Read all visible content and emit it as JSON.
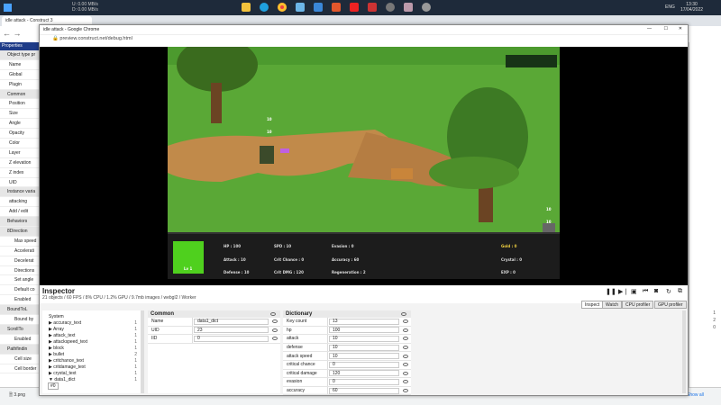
{
  "taskbar": {
    "net_up": "0.00 MB/s",
    "net_down": "0.00 MB/s",
    "net_u": "U:",
    "net_d": "D:",
    "lang": "ENG",
    "time": "13:30",
    "date": "17/04/2022"
  },
  "bg_browser": {
    "tab_title": "idle attack - Construct 3",
    "download_file": "3.png",
    "show_all": "Show all"
  },
  "properties": {
    "header": "Properties",
    "rows": [
      {
        "label": "Object type pr",
        "kind": "sec"
      },
      {
        "label": "Name"
      },
      {
        "label": "Global"
      },
      {
        "label": "Plugin"
      },
      {
        "label": "Common",
        "kind": "sec"
      },
      {
        "label": "Position"
      },
      {
        "label": "Size"
      },
      {
        "label": "Angle"
      },
      {
        "label": "Opacity"
      },
      {
        "label": "Color"
      },
      {
        "label": "Layer"
      },
      {
        "label": "Z elevation"
      },
      {
        "label": "Z index"
      },
      {
        "label": "UID"
      },
      {
        "label": "Instance varia",
        "kind": "sec"
      },
      {
        "label": "attacking"
      },
      {
        "label": "Add / edit"
      },
      {
        "label": "Behaviors",
        "kind": "sec"
      },
      {
        "label": "8Direction",
        "kind": "sec"
      },
      {
        "label": "Max speed",
        "kind": "sub"
      },
      {
        "label": "Accelerati",
        "kind": "sub"
      },
      {
        "label": "Decelerat",
        "kind": "sub"
      },
      {
        "label": "Directions",
        "kind": "sub"
      },
      {
        "label": "Set angle",
        "kind": "sub"
      },
      {
        "label": "Default co",
        "kind": "sub"
      },
      {
        "label": "Enabled",
        "kind": "sub"
      },
      {
        "label": "BoundToL",
        "kind": "sec"
      },
      {
        "label": "Bound by",
        "kind": "sub"
      },
      {
        "label": "ScrollTo",
        "kind": "sec"
      },
      {
        "label": "Enabled",
        "kind": "sub"
      },
      {
        "label": "Pathfindin",
        "kind": "sec"
      },
      {
        "label": "Cell size",
        "kind": "sub"
      },
      {
        "label": "Cell border",
        "kind": "sub"
      }
    ]
  },
  "right_strip": {
    "values": [
      "1",
      "2",
      "0"
    ]
  },
  "window": {
    "title": "idle attack - Google Chrome",
    "url": "preview.construct.net/debug.html"
  },
  "game": {
    "hud": {
      "level": "Lv 1",
      "hp": "HP : 100",
      "spd": "SPD : 10",
      "evasion": "Evasion : 0",
      "gold": "Gold : 0",
      "attack": "Attack : 10",
      "crit_chance": "Crit Chance : 0",
      "accuracy": "Accuracy : 60",
      "crystal": "Crystal : 0",
      "defense": "Defense : 10",
      "crit_dmg": "Crit DMG : 120",
      "regen": "Regeneration : 2",
      "exp": "EXP : 0"
    },
    "dmg_popup_1": "10",
    "dmg_popup_2": "10",
    "enemy_hp_1": "10",
    "enemy_hp_2": "10"
  },
  "inspector": {
    "title": "Inspector",
    "stats": "21 objects / 60 FPS / 8% CPU / 1.2% GPU / 9.7mb images / webgl2 / Worker",
    "tabs": [
      "Inspect",
      "Watch",
      "CPU profiler",
      "GPU profiler"
    ],
    "tree": [
      {
        "label": "System",
        "count": ""
      },
      {
        "label": "▶ accuracy_text",
        "count": "1"
      },
      {
        "label": "▶ Array",
        "count": "1"
      },
      {
        "label": "▶ attack_text",
        "count": "1"
      },
      {
        "label": "▶ attackspeed_text",
        "count": "1"
      },
      {
        "label": "▶ block",
        "count": "1"
      },
      {
        "label": "▶ bullet",
        "count": "2"
      },
      {
        "label": "▶ critchance_text",
        "count": "1"
      },
      {
        "label": "▶ critdamage_text",
        "count": "1"
      },
      {
        "label": "▶ crystal_text",
        "count": "1"
      },
      {
        "label": "▼ data1_dict",
        "count": "1"
      }
    ],
    "tree_selected": "#0",
    "common": {
      "header": "Common",
      "rows": [
        {
          "k": "Name",
          "v": "data1_dict"
        },
        {
          "k": "UID",
          "v": "23"
        },
        {
          "k": "IID",
          "v": "0"
        }
      ]
    },
    "dictionary": {
      "header": "Dictionary",
      "rows": [
        {
          "k": "Key count",
          "v": "13"
        },
        {
          "k": "hp",
          "v": "100"
        },
        {
          "k": "attack",
          "v": "10"
        },
        {
          "k": "defense",
          "v": "10"
        },
        {
          "k": "attack speed",
          "v": "10"
        },
        {
          "k": "critical chance",
          "v": "0"
        },
        {
          "k": "critical damage",
          "v": "120"
        },
        {
          "k": "evasion",
          "v": "0"
        },
        {
          "k": "accuracy",
          "v": "60"
        }
      ]
    }
  }
}
